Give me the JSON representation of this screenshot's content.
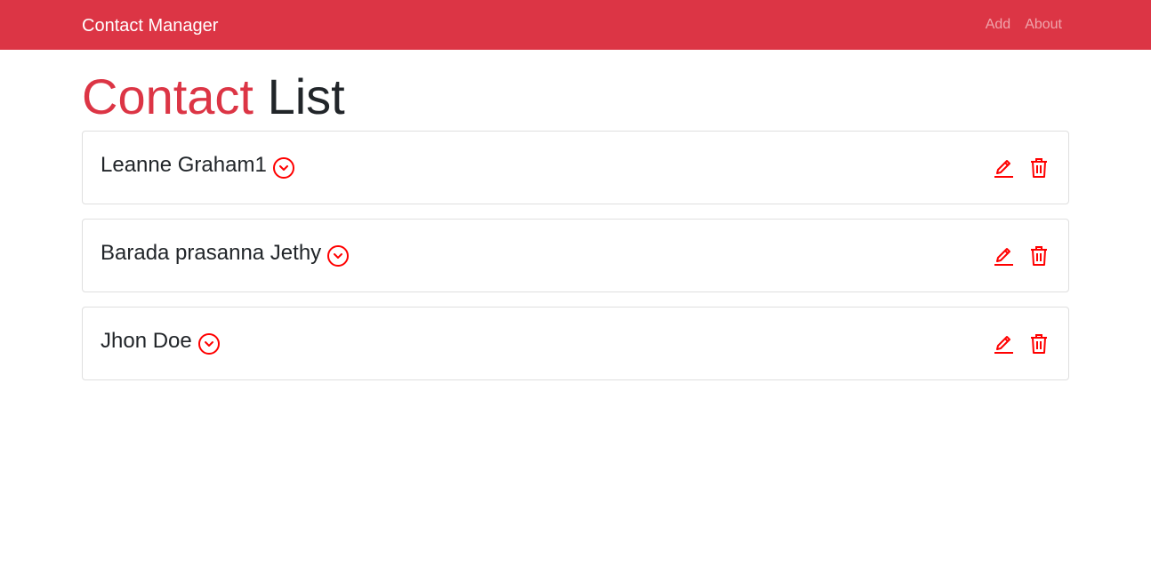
{
  "navbar": {
    "brand": "Contact Manager",
    "links": [
      {
        "label": "Add"
      },
      {
        "label": "About"
      }
    ]
  },
  "page": {
    "title_accent": "Contact",
    "title_rest": "List"
  },
  "contacts": [
    {
      "name": "Leanne Graham1"
    },
    {
      "name": "Barada prasanna Jethy"
    },
    {
      "name": "Jhon Doe"
    }
  ],
  "icons": {
    "expand": "chevron-down-circle-icon",
    "edit": "pencil-icon",
    "delete": "trash-icon"
  },
  "colors": {
    "accent": "#dc3545",
    "icon": "#ff0000",
    "text": "#212529"
  }
}
